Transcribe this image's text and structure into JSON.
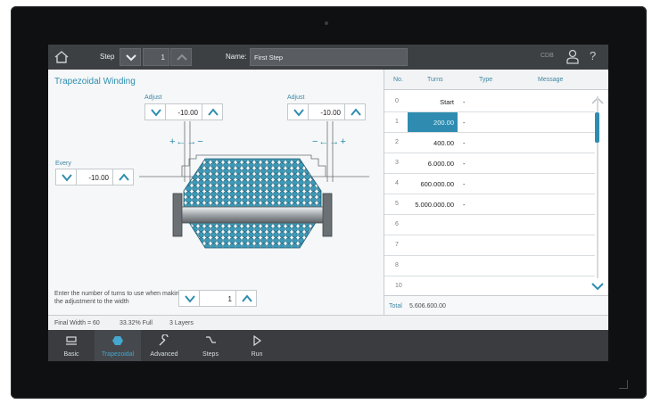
{
  "topbar": {
    "step_label": "Step",
    "step_value": "1",
    "name_label": "Name:",
    "name_value": "First Step",
    "cdb": "CDB"
  },
  "panel": {
    "title": "Trapezoidal Winding",
    "adjust_left_label": "Adjust",
    "adjust_left_value": "-10.00",
    "adjust_right_label": "Adjust",
    "adjust_right_value": "-10.00",
    "every_label": "Every",
    "every_value": "-10.00",
    "left_pm": "+←→−",
    "right_pm": "−←→+",
    "hint": "Enter the number of turns to use when making the adjustment to the width",
    "hint_value": "1"
  },
  "status": {
    "final_width": "Final Width = 60",
    "full": "33.32% Full",
    "layers": "3 Layers"
  },
  "table": {
    "headers": [
      "No.",
      "Turns",
      "Type",
      "Message"
    ],
    "rows": [
      {
        "no": "0",
        "turns": "Start",
        "type": "-"
      },
      {
        "no": "1",
        "turns": "200.00",
        "type": "-"
      },
      {
        "no": "2",
        "turns": "400.00",
        "type": "-"
      },
      {
        "no": "3",
        "turns": "6.000.00",
        "type": "-"
      },
      {
        "no": "4",
        "turns": "600.000.00",
        "type": "-"
      },
      {
        "no": "5",
        "turns": "5.000.000.00",
        "type": "-"
      },
      {
        "no": "6",
        "turns": "",
        "type": ""
      },
      {
        "no": "7",
        "turns": "",
        "type": ""
      },
      {
        "no": "8",
        "turns": "",
        "type": ""
      },
      {
        "no": "10",
        "turns": "",
        "type": ""
      }
    ],
    "total_label": "Total",
    "total_value": "5.606.600.00"
  },
  "toolbar": {
    "items": [
      {
        "label": "Basic",
        "icon": "printer-icon"
      },
      {
        "label": "Trapezoidal",
        "icon": "spool-icon"
      },
      {
        "label": "Advanced",
        "icon": "wrench-icon"
      },
      {
        "label": "Steps",
        "icon": "steps-icon"
      },
      {
        "label": "Run",
        "icon": "play-icon"
      }
    ]
  },
  "colors": {
    "accent": "#2f8cb0",
    "topbar": "#3d4043",
    "bezel": "#0f1012"
  }
}
